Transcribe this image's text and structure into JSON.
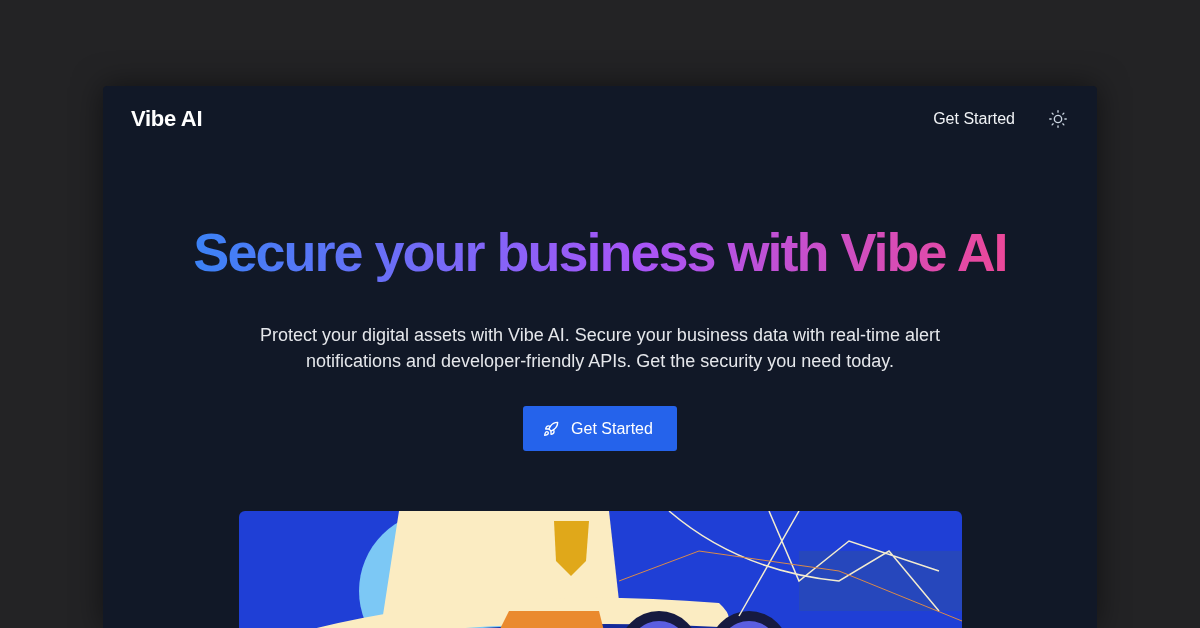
{
  "nav": {
    "brand": "Vibe AI",
    "link": "Get Started"
  },
  "hero": {
    "title": "Secure your business with Vibe AI",
    "description": "Protect your digital assets with Vibe AI. Secure your business data with real-time alert notifications and developer-friendly APIs. Get the security you need today.",
    "button": "Get Started"
  }
}
